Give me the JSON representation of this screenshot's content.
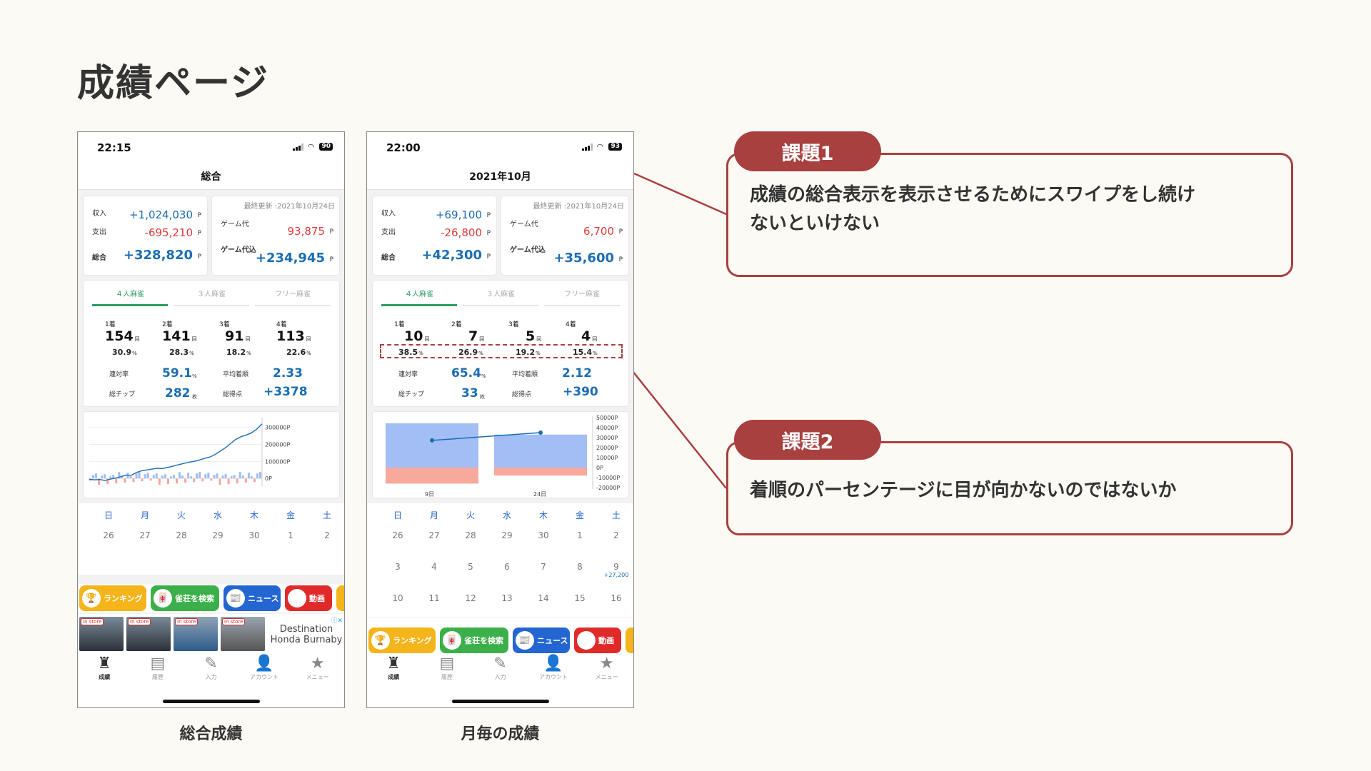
{
  "page_title": "成績ページ",
  "colors": {
    "accent": "#a84040",
    "blue": "#1c6db4",
    "red": "#e03a3a",
    "green": "#2e9c61"
  },
  "phones": [
    {
      "caption": "総合成績",
      "time": "22:15",
      "battery": "90",
      "nav_title": "総合",
      "summary": {
        "income_label": "収入",
        "income": "+1,024,030",
        "expense_label": "支出",
        "expense": "-695,210",
        "total_label": "総合",
        "total": "+328,820",
        "unit": "P",
        "updated": "最終更新 :2021年10月24日",
        "game_fee_label": "ゲーム代",
        "game_fee": "93,875",
        "incl_label": "ゲーム代込",
        "incl": "+234,945"
      },
      "tabs": [
        "４人麻雀",
        "３人麻雀",
        "フリー麻雀"
      ],
      "ranks": [
        {
          "label": "1着",
          "count": "154",
          "pct": "30.9"
        },
        {
          "label": "2着",
          "count": "141",
          "pct": "28.3"
        },
        {
          "label": "3着",
          "count": "91",
          "pct": "18.2"
        },
        {
          "label": "4着",
          "count": "113",
          "pct": "22.6"
        }
      ],
      "rank_unit": "回",
      "pct_unit": "%",
      "stats": {
        "rentai_label": "連対率",
        "rentai": "59.1",
        "rentai_unit": "%",
        "avg_label": "平均着順",
        "avg": "2.33",
        "chip_label": "総チップ",
        "chip": "282",
        "chip_unit": "枚",
        "score_label": "総得点",
        "score": "+3378"
      },
      "week": [
        "日",
        "月",
        "火",
        "水",
        "木",
        "金",
        "土"
      ],
      "days": [
        "26",
        "27",
        "28",
        "29",
        "30",
        "1",
        "2"
      ],
      "promo": [
        "ランキング",
        "雀荘を検索",
        "ニュース",
        "動画"
      ],
      "ad": {
        "in_store": "In store",
        "line1": "Destination",
        "line2": "Honda Burnaby"
      },
      "tabbar": [
        "成績",
        "履歴",
        "入力",
        "アカウント",
        "メニュー"
      ]
    },
    {
      "caption": "月毎の成績",
      "time": "22:00",
      "battery": "93",
      "nav_title": "2021年10月",
      "summary": {
        "income_label": "収入",
        "income": "+69,100",
        "expense_label": "支出",
        "expense": "-26,800",
        "total_label": "総合",
        "total": "+42,300",
        "unit": "P",
        "updated": "最終更新 :2021年10月24日",
        "game_fee_label": "ゲーム代",
        "game_fee": "6,700",
        "incl_label": "ゲーム代込",
        "incl": "+35,600"
      },
      "tabs": [
        "４人麻雀",
        "３人麻雀",
        "フリー麻雀"
      ],
      "ranks": [
        {
          "label": "1着",
          "count": "10",
          "pct": "38.5"
        },
        {
          "label": "2着",
          "count": "7",
          "pct": "26.9"
        },
        {
          "label": "3着",
          "count": "5",
          "pct": "19.2"
        },
        {
          "label": "4着",
          "count": "4",
          "pct": "15.4"
        }
      ],
      "rank_unit": "回",
      "pct_unit": "%",
      "stats": {
        "rentai_label": "連対率",
        "rentai": "65.4",
        "rentai_unit": "%",
        "avg_label": "平均着順",
        "avg": "2.12",
        "chip_label": "総チップ",
        "chip": "33",
        "chip_unit": "枚",
        "score_label": "総得点",
        "score": "+390"
      },
      "week": [
        "日",
        "月",
        "火",
        "水",
        "木",
        "金",
        "土"
      ],
      "days_rows": [
        [
          "26",
          "27",
          "28",
          "29",
          "30",
          "1",
          "2"
        ],
        [
          "3",
          "4",
          "5",
          "6",
          "7",
          "8",
          "9"
        ],
        [
          "10",
          "11",
          "12",
          "13",
          "14",
          "15",
          "16"
        ]
      ],
      "day_note": "+27,200",
      "promo": [
        "ランキング",
        "雀荘を検索",
        "ニュース",
        "動画"
      ],
      "tabbar": [
        "成績",
        "履歴",
        "入力",
        "アカウント",
        "メニュー"
      ]
    }
  ],
  "chart_data": [
    {
      "type": "line",
      "y_axis_right": [
        "300000P",
        "200000P",
        "100000P",
        "0P"
      ],
      "ylim": [
        -20000,
        340000
      ],
      "series": [
        {
          "values": [
            -5000,
            -8000,
            -6000,
            -12000,
            -4000,
            2000,
            10000,
            20000,
            18000,
            35000,
            45000,
            50000,
            55000,
            60000,
            58000,
            65000,
            72000,
            80000,
            88000,
            95000,
            100000,
            108000,
            118000,
            125000,
            140000,
            160000,
            180000,
            205000,
            230000,
            245000,
            255000,
            268000,
            290000,
            320000
          ]
        }
      ]
    },
    {
      "type": "bar",
      "categories": [
        "9日",
        "24日"
      ],
      "y_axis_right": [
        "50000P",
        "40000P",
        "30000P",
        "20000P",
        "10000P",
        "0P",
        "-10000P",
        "-20000P"
      ],
      "ylim": [
        -20000,
        50000
      ],
      "series": [
        {
          "values": [
            44300,
            33000
          ]
        },
        {
          "values": [
            -16000,
            -8000
          ]
        },
        {
          "values": [
            27200,
            35000
          ]
        }
      ]
    }
  ],
  "issues": [
    {
      "tag": "課題1",
      "text_line1": "成績の総合表示を表示させるためにスワイプをし続け",
      "text_line2": "ないといけない"
    },
    {
      "tag": "課題2",
      "text_line1": "着順のパーセンテージに目が向かないのではないか"
    }
  ]
}
